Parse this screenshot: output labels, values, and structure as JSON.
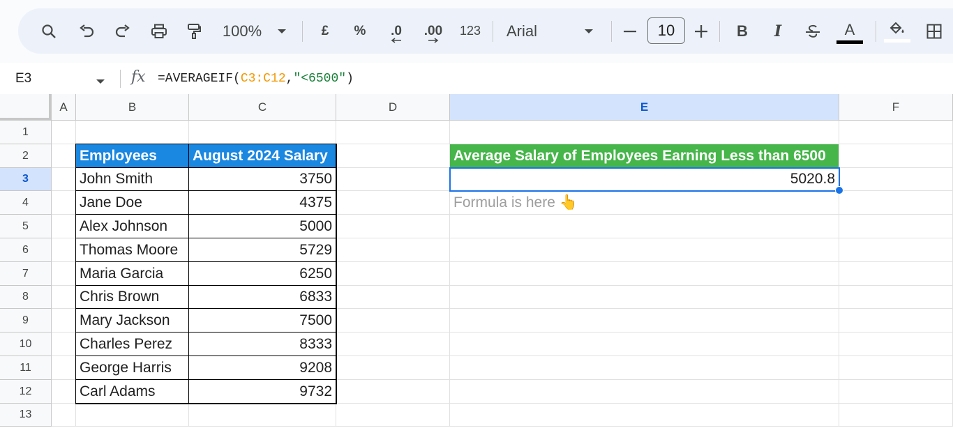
{
  "toolbar": {
    "zoom": "100%",
    "currency": "£",
    "percent": "%",
    "decrease_decimal": ".0",
    "increase_decimal": ".00",
    "more_formats": "123",
    "font": "Arial",
    "font_size": "10",
    "bold": "B",
    "italic": "I",
    "text_color_letter": "A",
    "text_color": "#000000",
    "fill_color": "#ffffff"
  },
  "formula_bar": {
    "name_box": "E3",
    "fx": "fx",
    "formula_prefix": "=AVERAGEIF(",
    "formula_range": "C3:C12",
    "formula_comma": ",",
    "formula_criteria": "\"<6500\"",
    "formula_suffix": ")"
  },
  "columns": [
    "A",
    "B",
    "C",
    "D",
    "E",
    "F"
  ],
  "rows": [
    "1",
    "2",
    "3",
    "4",
    "5",
    "6",
    "7",
    "8",
    "9",
    "10",
    "11",
    "12",
    "13"
  ],
  "table": {
    "header_employees": "Employees",
    "header_salary": "August 2024 Salary",
    "header_color": "#1a87e1",
    "rows": [
      {
        "name": "John Smith",
        "salary": "3750"
      },
      {
        "name": "Jane Doe",
        "salary": "4375"
      },
      {
        "name": "Alex Johnson",
        "salary": "5000"
      },
      {
        "name": "Thomas Moore",
        "salary": "5729"
      },
      {
        "name": "Maria Garcia",
        "salary": "6250"
      },
      {
        "name": "Chris Brown",
        "salary": "6833"
      },
      {
        "name": "Mary Jackson",
        "salary": "7500"
      },
      {
        "name": "Charles Perez",
        "salary": "8333"
      },
      {
        "name": "George Harris",
        "salary": "9208"
      },
      {
        "name": "Carl Adams",
        "salary": "9732"
      }
    ]
  },
  "result": {
    "header": "Average Salary of Employees Earning Less than 6500",
    "header_color": "#46b54a",
    "value": "5020.8",
    "note": "Formula is here 👆"
  },
  "colors": {
    "selection": "#1a73e8",
    "selected_header": "#d3e3fd"
  }
}
